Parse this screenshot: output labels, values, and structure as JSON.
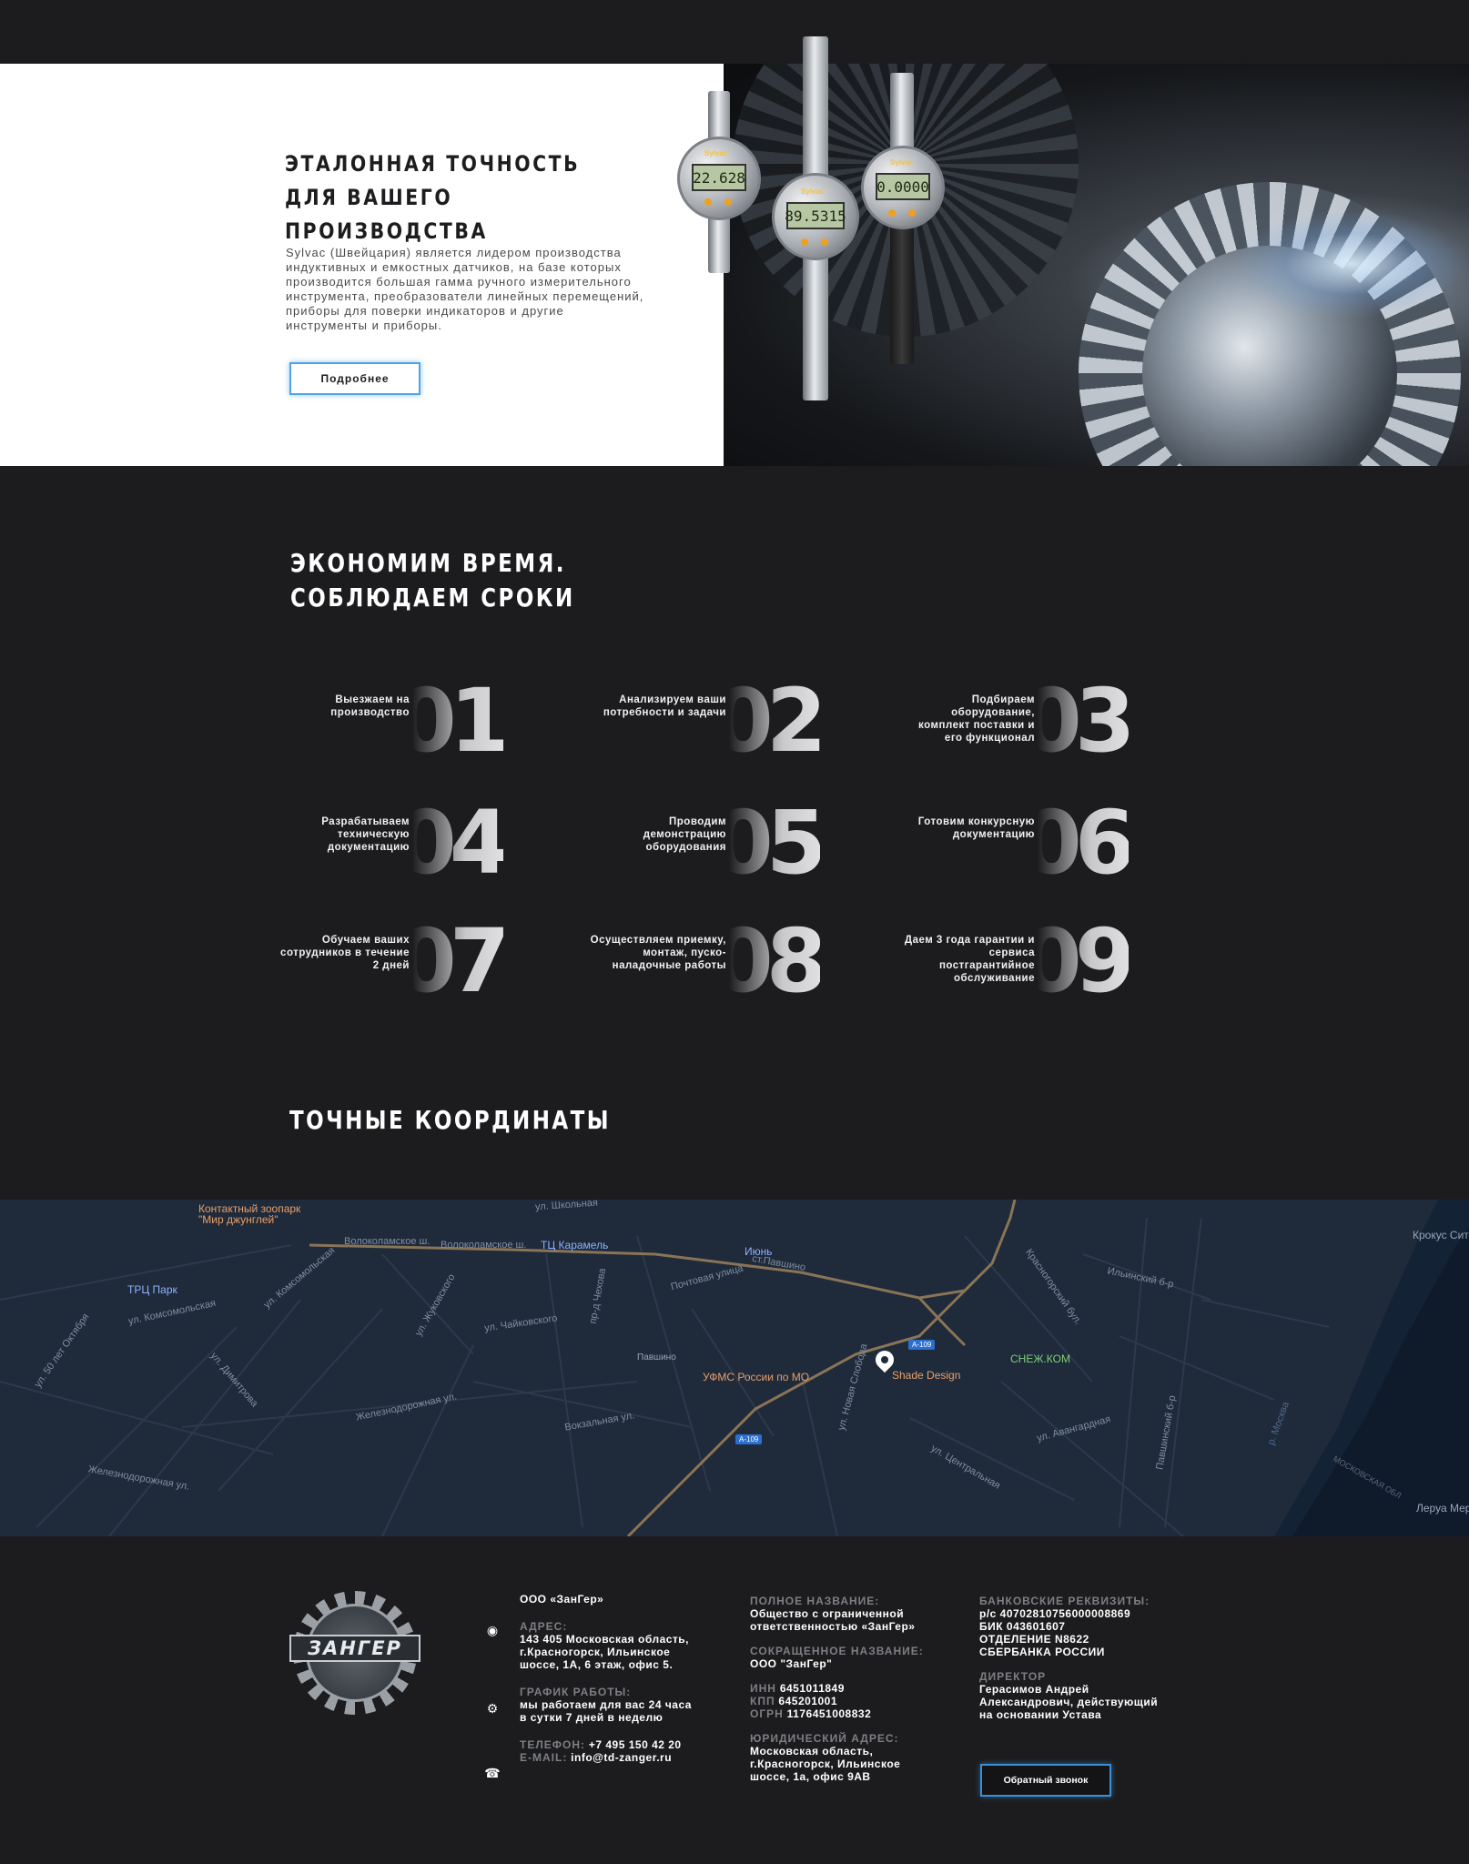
{
  "hero": {
    "title_line1": "ЭТАЛОННАЯ ТОЧНОСТЬ",
    "title_line2": "ДЛЯ ВАШЕГО ПРОИЗВОДСТВА",
    "text": "Sylvac (Швейцария) является лидером производства индуктивных и емкостных датчиков, на базе которых производится большая гамма ручного измерительного инструмента, преобразователи линейных перемещений, приборы для поверки индикаторов и другие инструменты и приборы.",
    "button_label": "Подробнее",
    "indicators": [
      {
        "brand": "Sylvac",
        "reading": "22.628"
      },
      {
        "brand": "Sylvac",
        "reading": "89.5315"
      },
      {
        "brand": "Sylvac",
        "reading": "0.0000"
      }
    ]
  },
  "steps": {
    "title_line1": "ЭКОНОМИМ ВРЕМЯ.",
    "title_line2": "СОБЛЮДАЕМ СРОКИ",
    "items": [
      {
        "num": "01",
        "text": "Выезжаем на производство"
      },
      {
        "num": "02",
        "text": "Анализируем ваши потребности и задачи"
      },
      {
        "num": "03",
        "text": "Подбираем оборудование, комплект поставки и его функционал"
      },
      {
        "num": "04",
        "text": "Разрабатываем техническую документацию"
      },
      {
        "num": "05",
        "text": "Проводим демонстрацию оборудования"
      },
      {
        "num": "06",
        "text": "Готовим конкурсную документацию"
      },
      {
        "num": "07",
        "text": "Обучаем ваших сотрудников в течение 2 дней"
      },
      {
        "num": "08",
        "text": "Осуществляем приемку, монтаж, пуско-наладочные работы"
      },
      {
        "num": "09",
        "text": "Даем 3 года гарантии и сервиса постгарантийное обслуживание"
      }
    ]
  },
  "coords": {
    "title": "ТОЧНЫЕ КООРДИНАТЫ"
  },
  "map": {
    "pois": {
      "zoo": "Контактный зоопарк \"Мир джунглей\"",
      "trc_park": "ТРЦ Парк",
      "tc_karamel": "ТЦ Карамель",
      "iyun": "Июнь",
      "krokus": "Крокус Сит",
      "pavshino": "Павшино",
      "ufms": "УФМС России по МО",
      "shade": "Shade Design",
      "snezhkom": "СНЕЖ.КОМ",
      "leroy": "Леруа Мер"
    },
    "streets": {
      "volokolamskoe": "Волоколамское ш.",
      "volokolamskoe2": "Волоколамское ш.",
      "st_pavshino": "ст.Павшино",
      "komsomolskaya": "ул. Комсомольская",
      "komsomolskaya2": "ул. Комсомольская",
      "chaikovskogo": "ул. Чайковского",
      "zhukovskogo": "ул. Жуковского",
      "dimitrova": "ул. Димитрова",
      "zheleznodorozhnaya": "Железнодорожная ул.",
      "zheleznodorozhnaya2": "Железнодорожная ул.",
      "vokzalnaya": "Вокзальная ул.",
      "centralnaya": "ул. Центральная",
      "ilinsky": "Ильинский б-р",
      "krasnogorsky": "Красногорский бул.",
      "pavshinsky": "Павшинский б-р",
      "let_oktyabrya": "ул. 50 лет Октября",
      "shkolnaya": "ул. Школьная",
      "pochtovaya": "Почтовая улица",
      "pr_chehova": "пр-д Чехова",
      "novaya_svoboda": "ул. Новая Слобода",
      "avangardnaya": "ул. Авангардная",
      "moskva_river": "р. Москва",
      "mo_obl": "МОСКОВСКАЯ ОБЛ",
      "a109": "A-109",
      "a109b": "A-109",
      "a109c": "A-109"
    }
  },
  "footer": {
    "logo_text": "ЗАНГЕР",
    "company": "ООО «ЗанГер»",
    "address_label": "АДРЕС:",
    "address": "143 405 Московская область, г.Красногорск, Ильинское шоссе, 1А, 6 этаж, офис 5.",
    "schedule_label": "ГРАФИК РАБОТЫ:",
    "schedule": "мы работаем для вас 24 часа в сутки 7 дней в неделю",
    "phone_label": "ТЕЛЕФОН:",
    "phone": "+7 495 150 42 20",
    "email_label": "E-MAIL:",
    "email": "info@td-zanger.ru",
    "full_name_label": "ПОЛНОЕ НАЗВАНИЕ:",
    "full_name": "Общество с ограниченной ответственностью «ЗанГер»",
    "short_name_label": "СОКРАЩЕННОЕ НАЗВАНИЕ:",
    "short_name": "ООО \"ЗанГер\"",
    "inn_label": "ИНН",
    "inn": "6451011849",
    "kpp_label": "КПП",
    "kpp": "645201001",
    "ogrn_label": "ОГРН",
    "ogrn": "1176451008832",
    "legal_address_label": "ЮРИДИЧЕСКИЙ АДРЕС:",
    "legal_address": "Московская область, г.Красногорск, Ильинское шоссе, 1а, офис 9АВ",
    "bank_label": "БАНКОВСКИЕ РЕКВИЗИТЫ:",
    "bank_account": "р/с 40702810756000008869",
    "bik": "БИК 043601607",
    "branch": "ОТДЕЛЕНИЕ N8622",
    "bank": "СБЕРБАНКА РОССИИ",
    "director_label": "ДИРЕКТОР",
    "director": "Герасимов Андрей Александрович, действующий на основании Устава",
    "callback_button": "Обратный звонок"
  }
}
